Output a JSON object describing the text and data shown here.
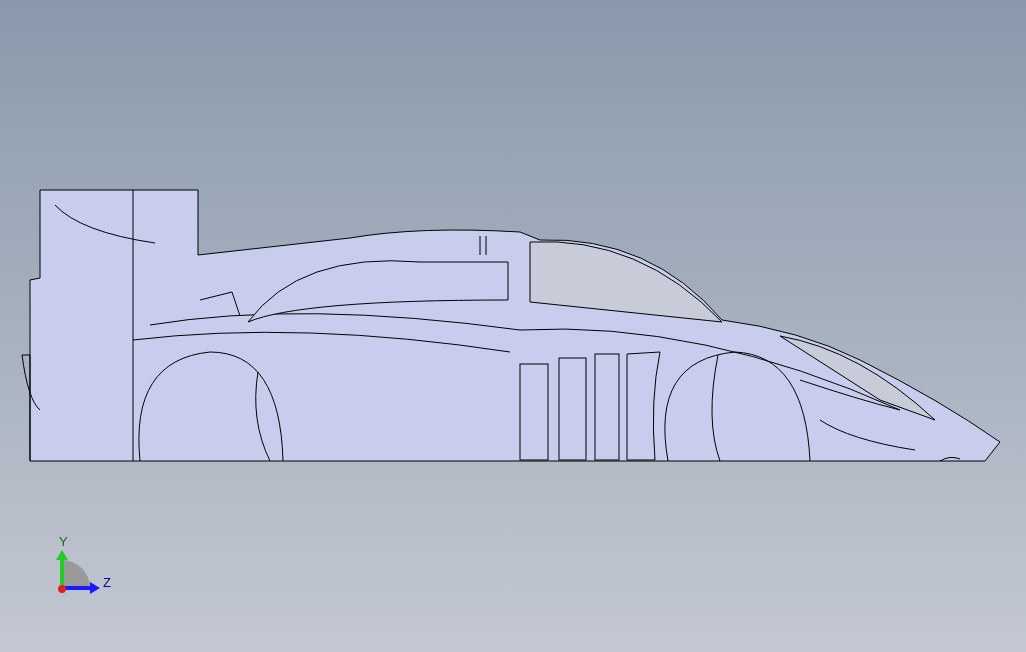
{
  "viewport": {
    "triad": {
      "axes": [
        {
          "label": "Y",
          "color": "#22cc22"
        },
        {
          "label": "Z",
          "color": "#1a1aff"
        }
      ]
    }
  }
}
